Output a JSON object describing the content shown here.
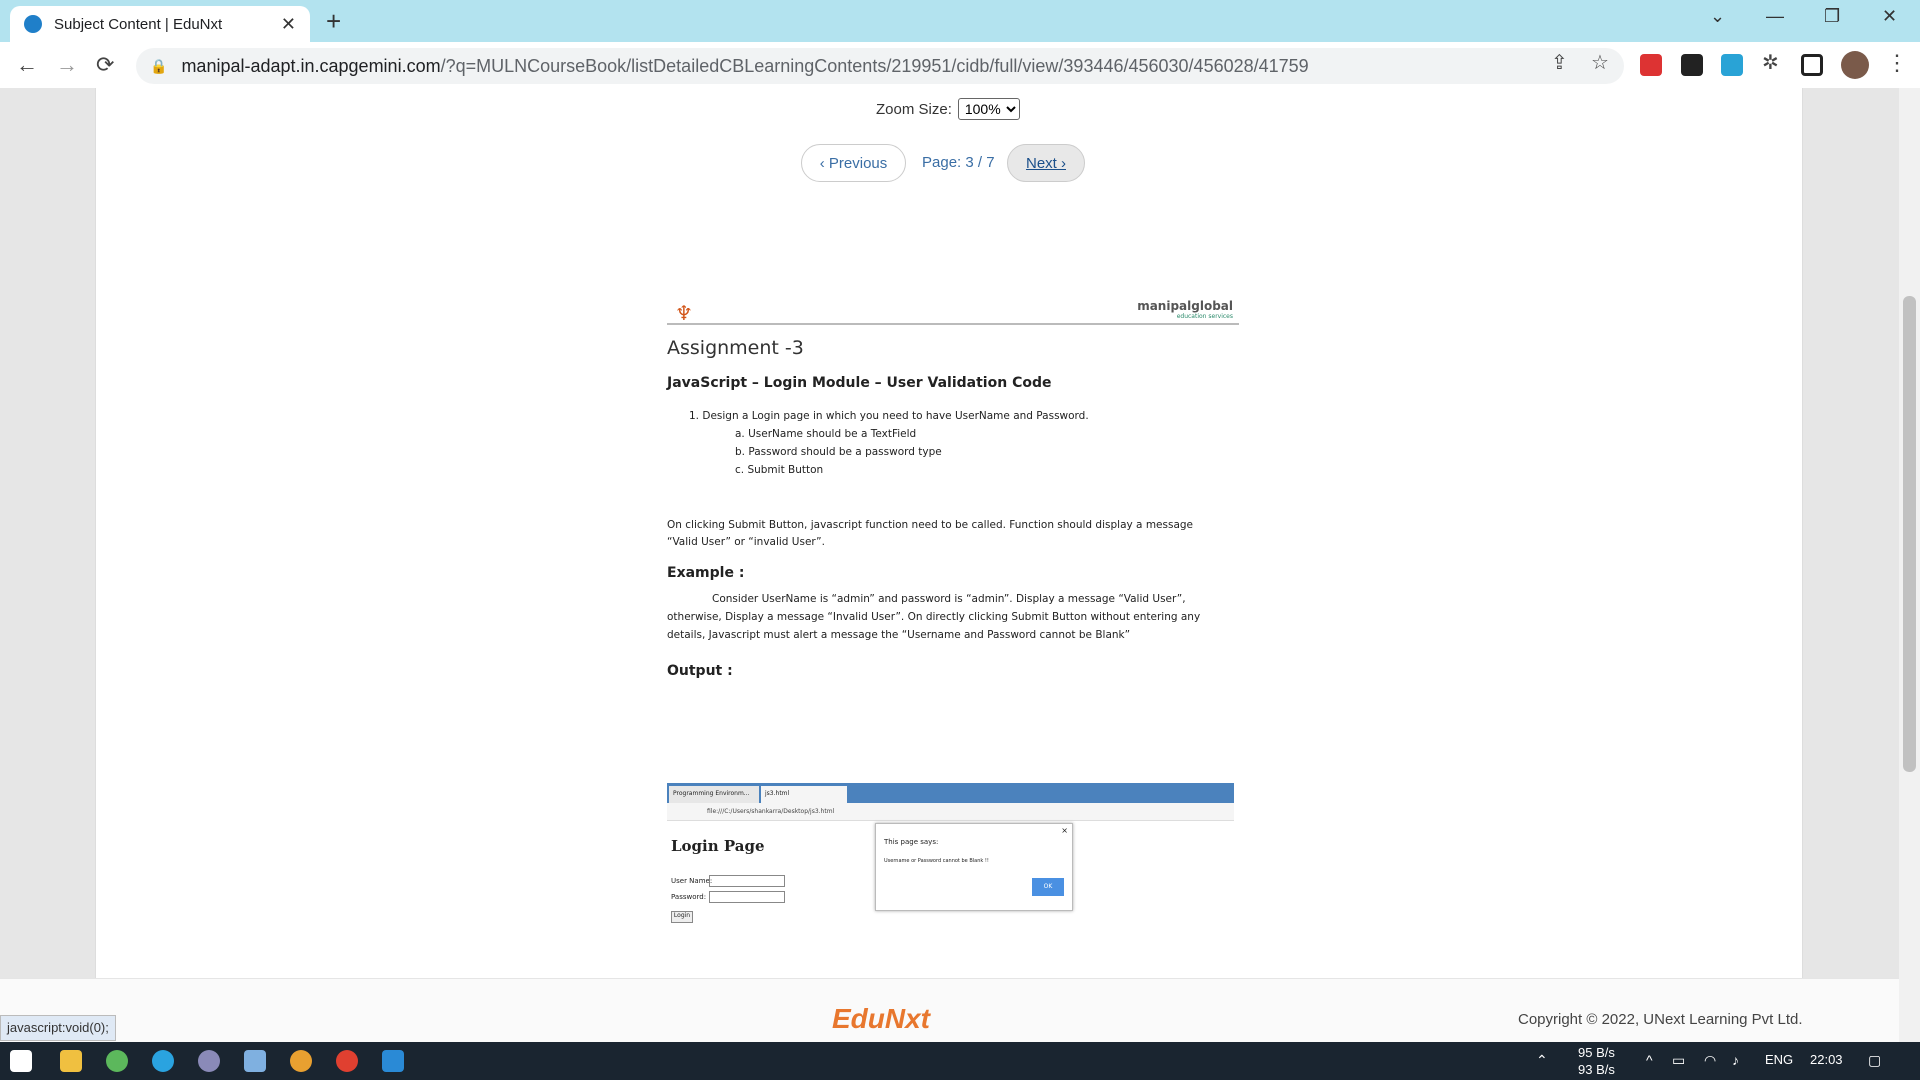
{
  "browser": {
    "tab_title": "Subject Content | EduNxt",
    "tab_close": "✕",
    "new_tab": "+",
    "url_domain": "manipal-adapt.in.capgemini.com",
    "url_path": "/?q=MULNCourseBook/listDetailedCBLearningContents/219951/cidb/full/view/393446/456030/456028/41759"
  },
  "viewer": {
    "zoom_label": "Zoom Size:",
    "zoom_value": "100%",
    "previous_label": "‹ Previous",
    "page_info": "Page: 3 / 7",
    "next_label": "Next ›"
  },
  "document": {
    "brand": "manipalglobal",
    "brand_sub": "education services",
    "title": "Assignment -3",
    "subtitle": "JavaScript – Login Module – User Validation Code",
    "item1": "1.    Design a Login page in which you need to have UserName and Password.",
    "item1a": "a.    UserName should be a TextField",
    "item1b": "b.    Password should be a password type",
    "item1c": "c.    Submit Button",
    "para1_line1": "On clicking Submit Button, javascript function need to be called. Function should display a message",
    "para1_line2": "“Valid User”  or  “invalid User”.",
    "example_heading": "Example :",
    "example_line1": "Consider UserName is “admin” and password is “admin”. Display a message “Valid User”,",
    "example_line2": "otherwise, Display a message “Invalid User”. On directly clicking Submit Button without entering any",
    "example_line3": "details, Javascript must alert a message the “Username and Password cannot be Blank”",
    "output_heading": "Output :",
    "screenshot": {
      "tab1": "Programming Environm...",
      "tab2": "js3.html",
      "address": "file:///C:/Users/shankarra/Desktop/js3.html",
      "page_heading": "Login Page",
      "username_label": "User Name:",
      "password_label": "Password:",
      "login_button": "Login",
      "dialog_title": "This page says:",
      "dialog_message": "Username or Password cannot be Blank !!",
      "dialog_ok": "OK"
    }
  },
  "footer": {
    "logo": "EduNxt",
    "copyright": "Copyright © 2022, UNext Learning Pvt Ltd."
  },
  "status_bar": "javascript:void(0);",
  "taskbar": {
    "net_up": "95 B/s",
    "net_down": "93 B/s",
    "lang": "ENG",
    "time": "22:03"
  }
}
